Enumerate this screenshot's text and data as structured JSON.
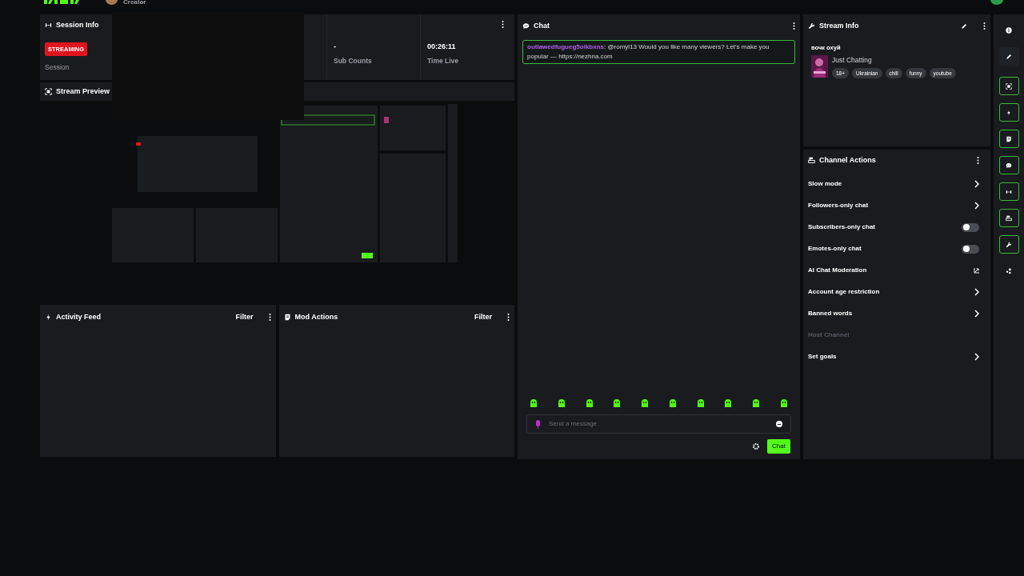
{
  "top_bar": {
    "role": "Creator"
  },
  "session_info": {
    "title": "Session Info",
    "badge": "STREAMING",
    "label": "Session",
    "stats": [
      {
        "value": "-",
        "label": "Sub Counts"
      },
      {
        "value": "00:26:11",
        "label": "Time Live"
      }
    ]
  },
  "stream_preview": {
    "title": "Stream Preview"
  },
  "panels": [
    {
      "kind": "bolt",
      "title": "Activity Feed",
      "filter": "Filter"
    },
    {
      "kind": "doc",
      "title": "Mod Actions",
      "filter": "Filter"
    }
  ],
  "chat": {
    "title": "Chat",
    "messages": [
      {
        "username": "outlawedfugueg5olkbxns",
        "text": ": @romyl13 Would you like many viewers? Let's make you popular — https://nezhna.com",
        "highlighted": true
      }
    ],
    "input": {
      "placeholder": "Send a message"
    },
    "send_button": "Chat"
  },
  "stream_info": {
    "title": "Stream Info",
    "stream_title": "вочк охуй",
    "category": "Just Chatting",
    "tags": [
      "18+",
      "Ukrainian",
      "chill",
      "funny",
      "youtube"
    ]
  },
  "channel_actions": {
    "title": "Channel Actions",
    "items": [
      {
        "label": "Slow mode",
        "kind": "chevron",
        "disabled": false
      },
      {
        "label": "Followers-only chat",
        "kind": "chevron",
        "disabled": false
      },
      {
        "label": "Subscribers-only chat",
        "kind": "toggle",
        "on": false,
        "disabled": false
      },
      {
        "label": "Emotes-only chat",
        "kind": "toggle",
        "on": false,
        "disabled": false
      },
      {
        "label": "AI Chat Moderation",
        "kind": "external",
        "disabled": false
      },
      {
        "label": "Account age restriction",
        "kind": "chevron",
        "disabled": false
      },
      {
        "label": "Banned words",
        "kind": "chevron",
        "disabled": false
      },
      {
        "label": "Host Channel",
        "kind": "plain",
        "disabled": true
      },
      {
        "label": "Set goals",
        "kind": "chevron",
        "disabled": false
      }
    ]
  },
  "rail": [
    {
      "kind": "info",
      "active": false
    },
    {
      "kind": "pencil",
      "active": false
    },
    {
      "kind": "preview",
      "active": true
    },
    {
      "kind": "bolt",
      "active": true
    },
    {
      "kind": "doc",
      "active": true
    },
    {
      "kind": "chat",
      "active": true
    },
    {
      "kind": "session",
      "active": true
    },
    {
      "kind": "actions",
      "active": true
    },
    {
      "kind": "wrench",
      "active": true
    },
    {
      "kind": "dots",
      "active": false
    }
  ]
}
